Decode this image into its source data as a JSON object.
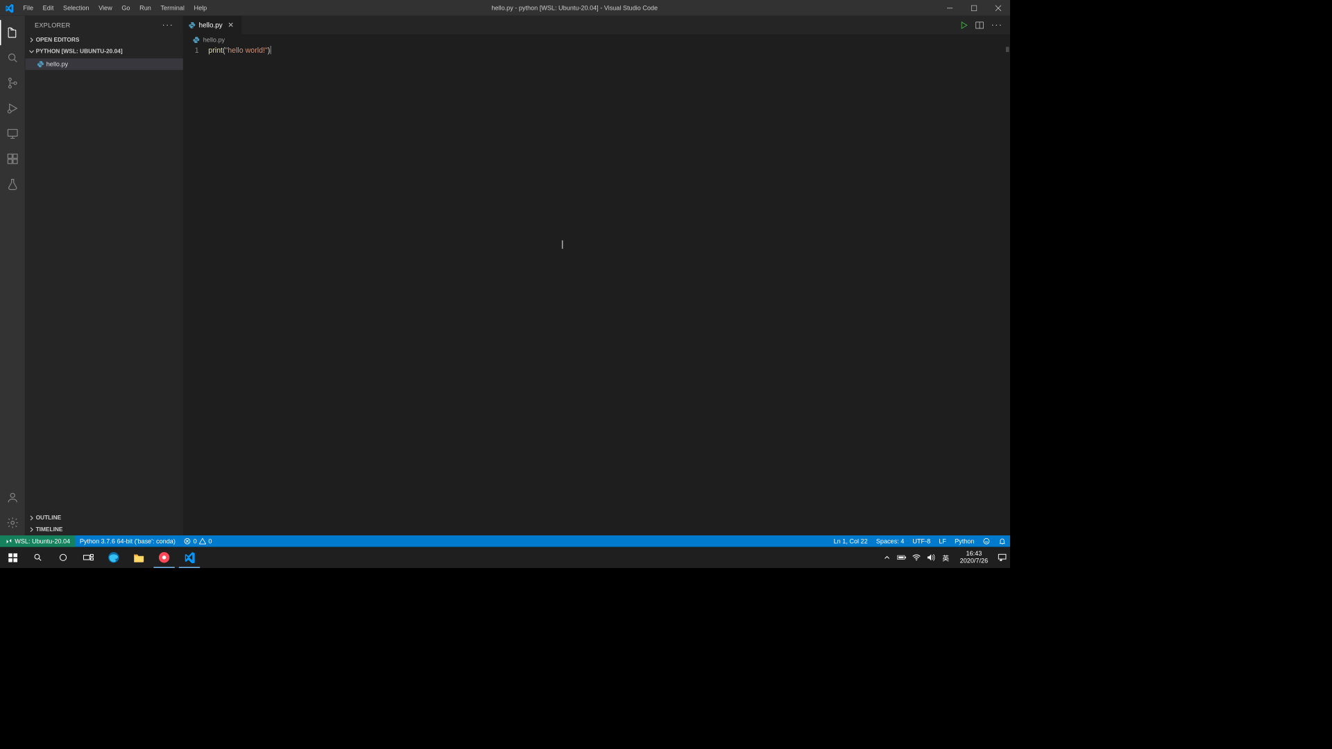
{
  "titlebar": {
    "menus": [
      "File",
      "Edit",
      "Selection",
      "View",
      "Go",
      "Run",
      "Terminal",
      "Help"
    ],
    "title": "hello.py - python [WSL: Ubuntu-20.04] - Visual Studio Code"
  },
  "activitybar": {
    "items": [
      "explorer",
      "search",
      "source-control",
      "run-debug",
      "remote-explorer",
      "extensions",
      "testing"
    ],
    "bottom": [
      "accounts",
      "settings"
    ]
  },
  "sidebar": {
    "title": "EXPLORER",
    "openEditorsLabel": "OPEN EDITORS",
    "workspaceLabel": "PYTHON [WSL: UBUNTU-20.04]",
    "files": [
      {
        "name": "hello.py"
      }
    ],
    "outlineLabel": "OUTLINE",
    "timelineLabel": "TIMELINE"
  },
  "tabs": [
    {
      "name": "hello.py"
    }
  ],
  "breadcrumb": {
    "file": "hello.py"
  },
  "code": {
    "lineNo": "1",
    "func": "print",
    "open": "(",
    "str": "\"hello world!\"",
    "close": ")"
  },
  "statusbar": {
    "remote": "WSL: Ubuntu-20.04",
    "python": "Python 3.7.6 64-bit ('base': conda)",
    "errors": "0",
    "warnings": "0",
    "cursor": "Ln 1, Col 22",
    "spaces": "Spaces: 4",
    "encoding": "UTF-8",
    "eol": "LF",
    "language": "Python"
  },
  "taskbar": {
    "ime": "英",
    "time": "16:43",
    "date": "2020/7/26"
  }
}
